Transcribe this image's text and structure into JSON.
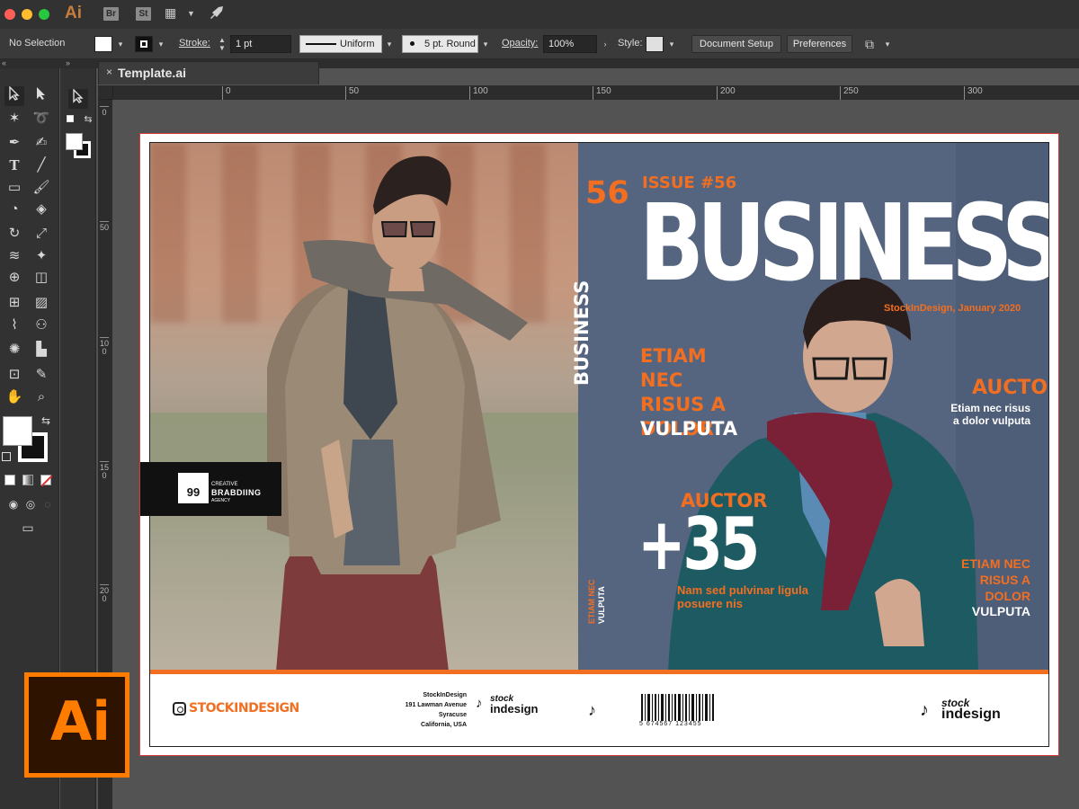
{
  "app": {
    "name": "Ai",
    "bridge_label": "Br",
    "stock_label": "St"
  },
  "control_bar": {
    "selection": "No Selection",
    "stroke_label": "Stroke:",
    "stroke_weight": "1 pt",
    "stroke_profile": "Uniform",
    "brush_label": "5 pt. Round",
    "opacity_label": "Opacity:",
    "opacity_value": "100%",
    "style_label": "Style:",
    "document_setup": "Document Setup",
    "preferences": "Preferences"
  },
  "document": {
    "tab_title": "Template.ai",
    "close_glyph": "×"
  },
  "rulers": {
    "horizontal": [
      "0",
      "50",
      "100",
      "150",
      "200",
      "250",
      "300"
    ],
    "vertical": [
      "0",
      "50",
      "100",
      "150",
      "200"
    ]
  },
  "cover": {
    "number": "56",
    "issue": "ISSUE #56",
    "title": "BUSINESS",
    "date": "StockInDesign, January 2020",
    "side_title": "BUSINESS",
    "headline1": "ETIAM NEC RISUS A DOLOR",
    "headline1_sub": "VULPUTA",
    "auctor1": "AUCTOR",
    "plus_number": "+35",
    "plus_text": "Nam sed pulvinar ligula posuere nis",
    "vertical_small_1": "ETIAM NEC",
    "vertical_small_2": "VULPUTA",
    "auctor2": "AUCTOR",
    "auctor2_text": "Etiam nec risus a dolor vulputa",
    "headline2": "ETIAM NEC RISUS A DOLOR",
    "headline2_sub": "VULPUTA"
  },
  "badge": {
    "number": "99",
    "line1": "CREATIVE",
    "line2": "BRABDIING",
    "line3": "AGENCY"
  },
  "footer": {
    "instagram": "STOCKINDESIGN",
    "address": [
      "StockInDesign",
      "191  Lawman Avenue",
      "Syracuse",
      "California, USA"
    ],
    "logo_line1": "stock",
    "logo_line2": "indesign",
    "barcode_number": "5 674567 123455"
  },
  "ai_logo_text": "Ai",
  "colors": {
    "accent": "#f26f21",
    "cover_blue": "#56657f",
    "ai_orange": "#ff7c00"
  }
}
